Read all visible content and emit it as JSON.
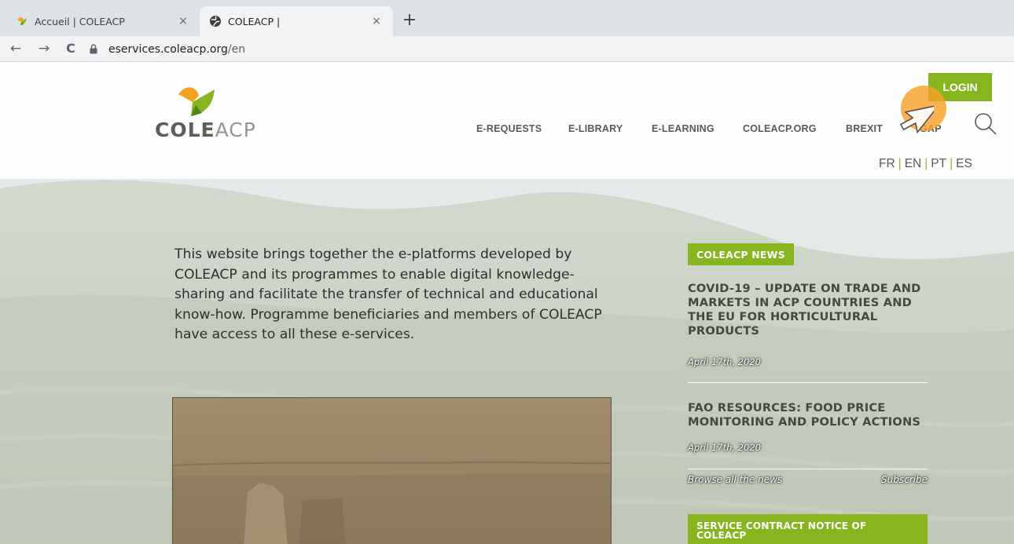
{
  "browser": {
    "tabs": [
      {
        "title": "Accueil | COLEACP",
        "active": false,
        "icon": "bird-favicon-icon"
      },
      {
        "title": "COLEACP |",
        "active": true,
        "icon": "globe-favicon-icon"
      }
    ],
    "close_glyph": "×",
    "new_tab_glyph": "+",
    "nav": {
      "back": "←",
      "forward": "→",
      "reload": "C"
    },
    "url_host": "eservices.coleacp.org",
    "url_path": "/en"
  },
  "site": {
    "logo": {
      "part1": "COLE",
      "part2": "ACP"
    },
    "nav": [
      {
        "label": "E-REQUESTS"
      },
      {
        "label": "E-LIBRARY"
      },
      {
        "label": "E-LEARNING"
      },
      {
        "label": "COLEACP.ORG"
      },
      {
        "label": "BREXIT"
      },
      {
        "label": "GAP"
      }
    ],
    "login": "LOGIN",
    "languages": [
      "FR",
      "EN",
      "PT",
      "ES"
    ],
    "intro": "This website brings together the e-platforms developed by COLEACP and its programmes to enable digital knowledge-sharing and facilitate the transfer of technical and educational know-how. Programme beneficiaries and members of COLEACP have access to all these e-services.",
    "news": {
      "badge": "COLEACP NEWS",
      "items": [
        {
          "title": "COVID-19 – UPDATE ON TRADE AND MARKETS IN ACP COUNTRIES AND THE EU FOR HORTICULTURAL PRODUCTS",
          "date": "April 17th, 2020"
        },
        {
          "title": "FAO RESOURCES: FOOD PRICE MONITORING AND POLICY ACTIONS",
          "date": "April 17th, 2020"
        }
      ],
      "browse": "Browse all the news",
      "subscribe": "Subscribe",
      "notice": "SERVICE CONTRACT NOTICE OF COLEACP"
    }
  },
  "colors": {
    "brand_green": "#87b51f",
    "brand_orange": "#f3a21f",
    "nav_text": "#5a5b54",
    "cursor_highlight": "#f6a22a"
  }
}
